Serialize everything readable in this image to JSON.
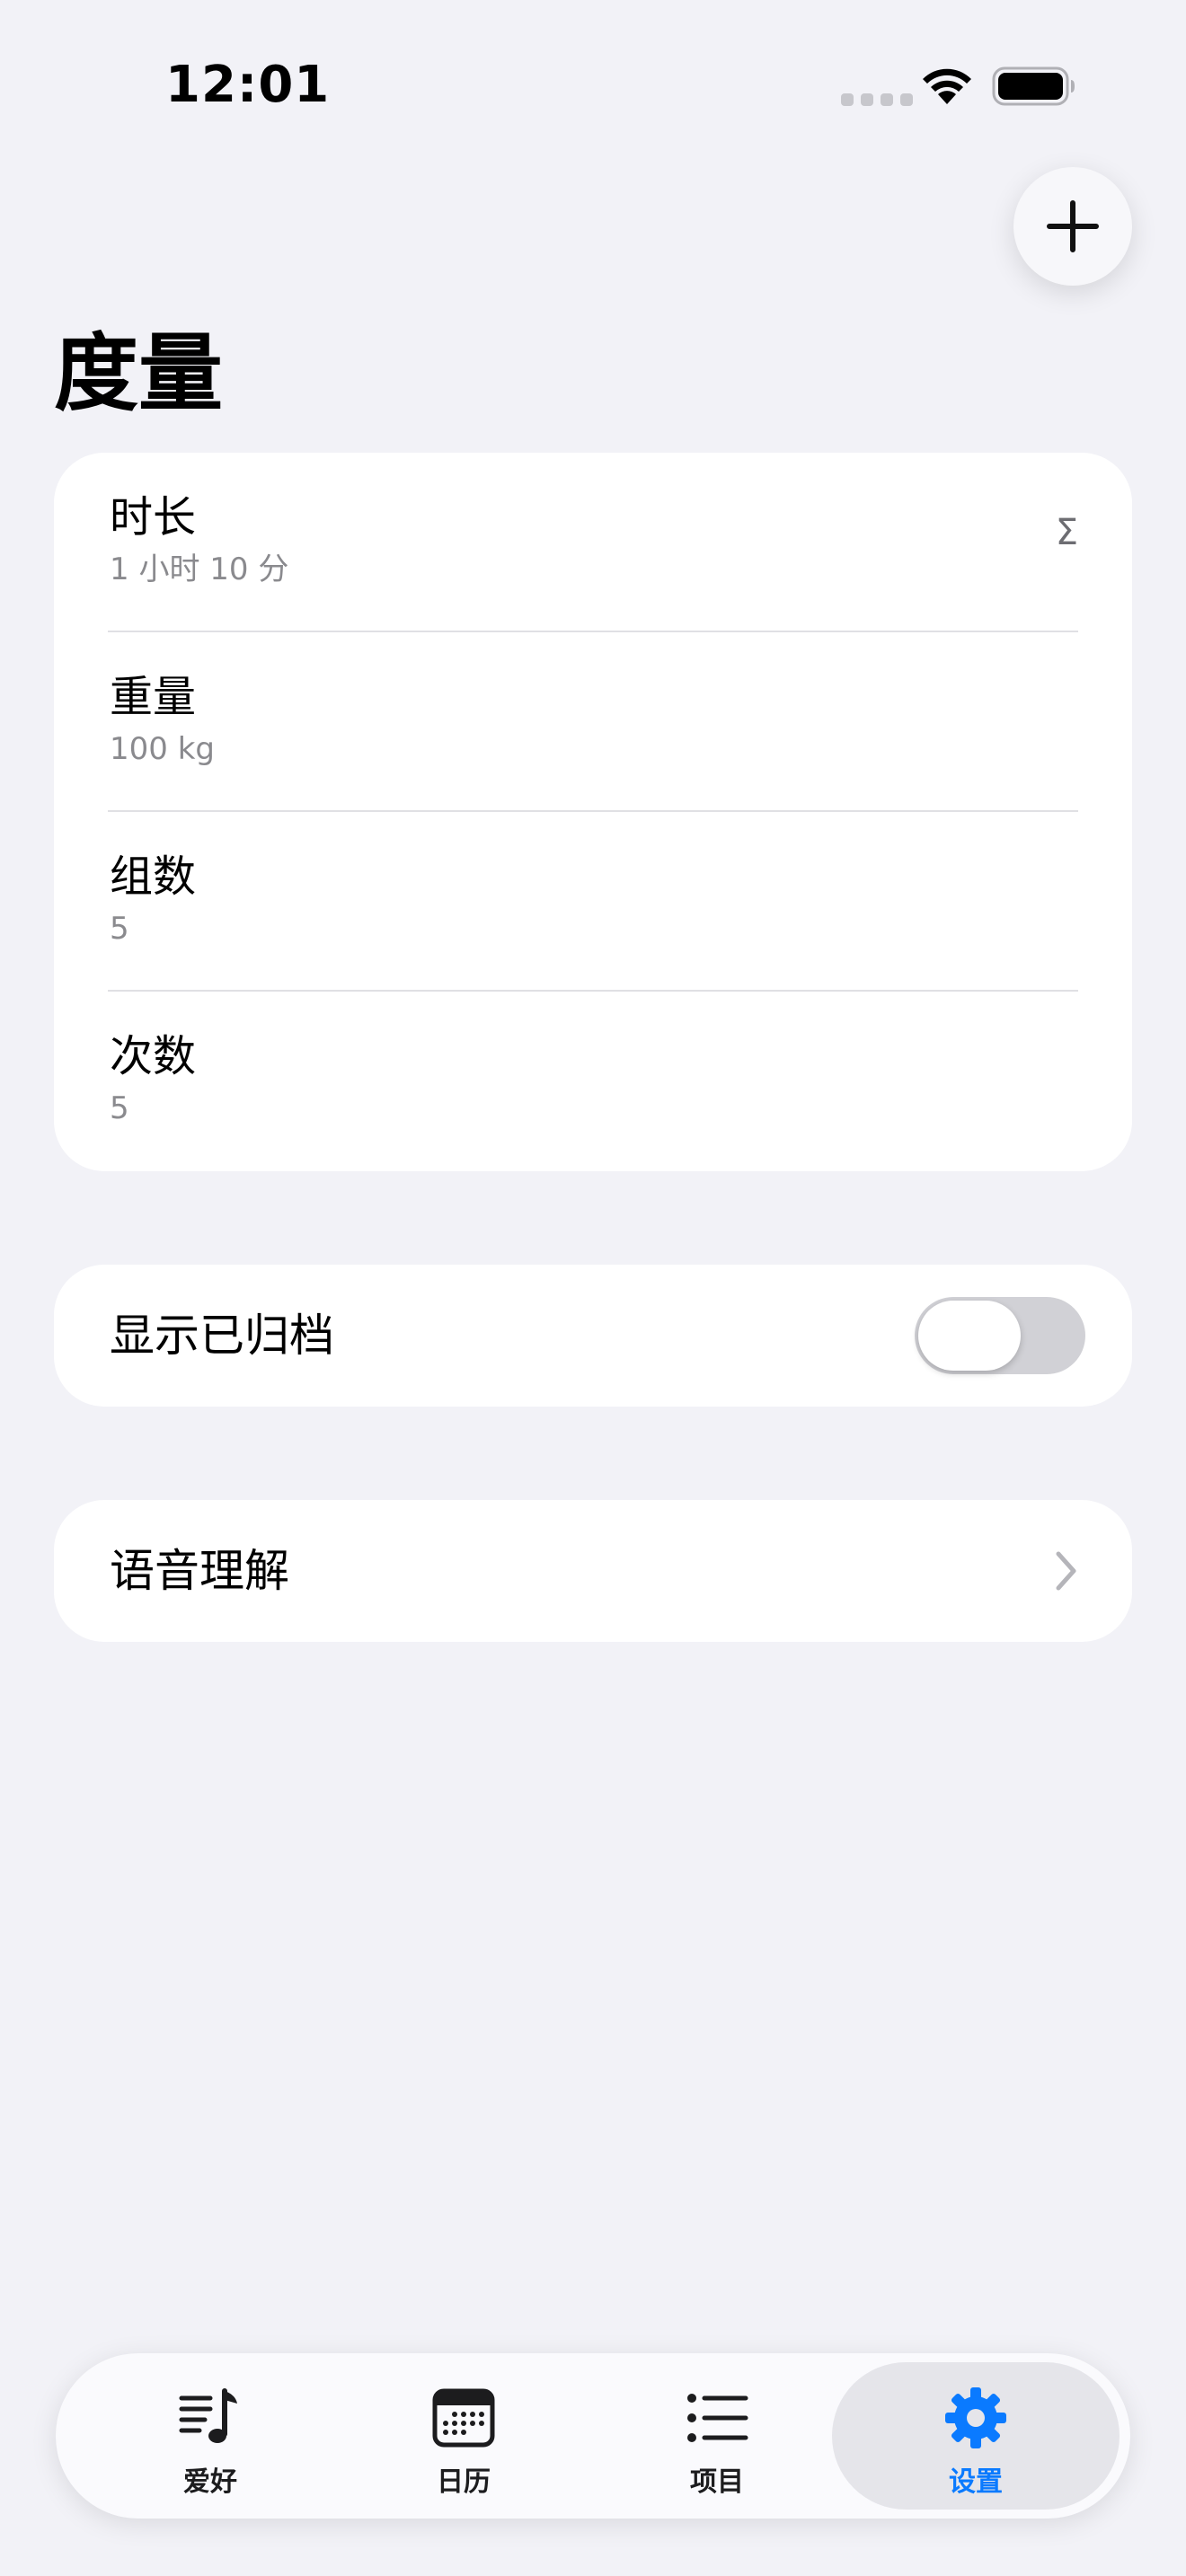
{
  "status_bar": {
    "time": "12:01"
  },
  "header": {
    "title": "度量",
    "add_icon": "plus-icon"
  },
  "metrics": [
    {
      "name": "时长",
      "value": "1 小时 10 分",
      "accessory": "Σ"
    },
    {
      "name": "重量",
      "value": "100 kg"
    },
    {
      "name": "组数",
      "value": "5"
    },
    {
      "name": "次数",
      "value": "5"
    }
  ],
  "archive": {
    "label": "显示已归档",
    "enabled": false
  },
  "voice": {
    "label": "语音理解"
  },
  "tab_bar": {
    "tabs": [
      {
        "label": "爱好",
        "icon": "music-list-icon"
      },
      {
        "label": "日历",
        "icon": "calendar-icon"
      },
      {
        "label": "项目",
        "icon": "list-icon"
      },
      {
        "label": "设置",
        "icon": "gear-icon",
        "active": true
      }
    ]
  },
  "colors": {
    "accent": "#0a7aff",
    "background": "#f2f2f7"
  }
}
